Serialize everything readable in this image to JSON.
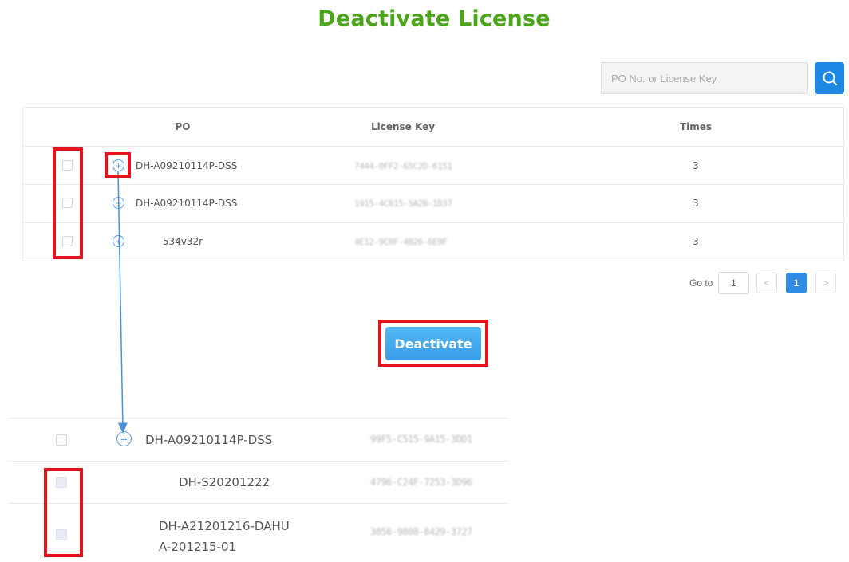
{
  "page": {
    "title": "Deactivate License"
  },
  "search": {
    "placeholder": "PO No. or License Key",
    "button_icon": "search-icon"
  },
  "table": {
    "headers": {
      "po": "PO",
      "license_key": "License Key",
      "times": "Times"
    },
    "rows": [
      {
        "po": "DH-A09210114P-DSS",
        "license_key": "7444-0FF2-65C2D-6151",
        "times": "3"
      },
      {
        "po": "DH-A09210114P-DSS",
        "license_key": "1915-4C615-5A2B-1D37",
        "times": "3"
      },
      {
        "po": "534v32r",
        "license_key": "4E12-9C0F-4B26-6E9F",
        "times": "3"
      }
    ]
  },
  "pagination": {
    "goto_label": "Go to",
    "goto_value": "1",
    "prev": "<",
    "current": "1",
    "next": ">"
  },
  "actions": {
    "deactivate_label": "Deactivate"
  },
  "zoom_table": {
    "rows": [
      {
        "po": "DH-A09210114P-DSS",
        "license_key": "99F5-C515-9A15-3DD1"
      },
      {
        "po": "DH-S20201222",
        "license_key": "4796-C24F-7253-3D96"
      },
      {
        "po_line1": "DH-A21201216-DAHU",
        "po_line2": "A-201215-01",
        "license_key": "3856-9808-8429-3727"
      }
    ]
  },
  "colors": {
    "title": "#4aa51a",
    "accent": "#1e88e5",
    "highlight": "#e3141e",
    "arrow": "#4a90d9"
  }
}
